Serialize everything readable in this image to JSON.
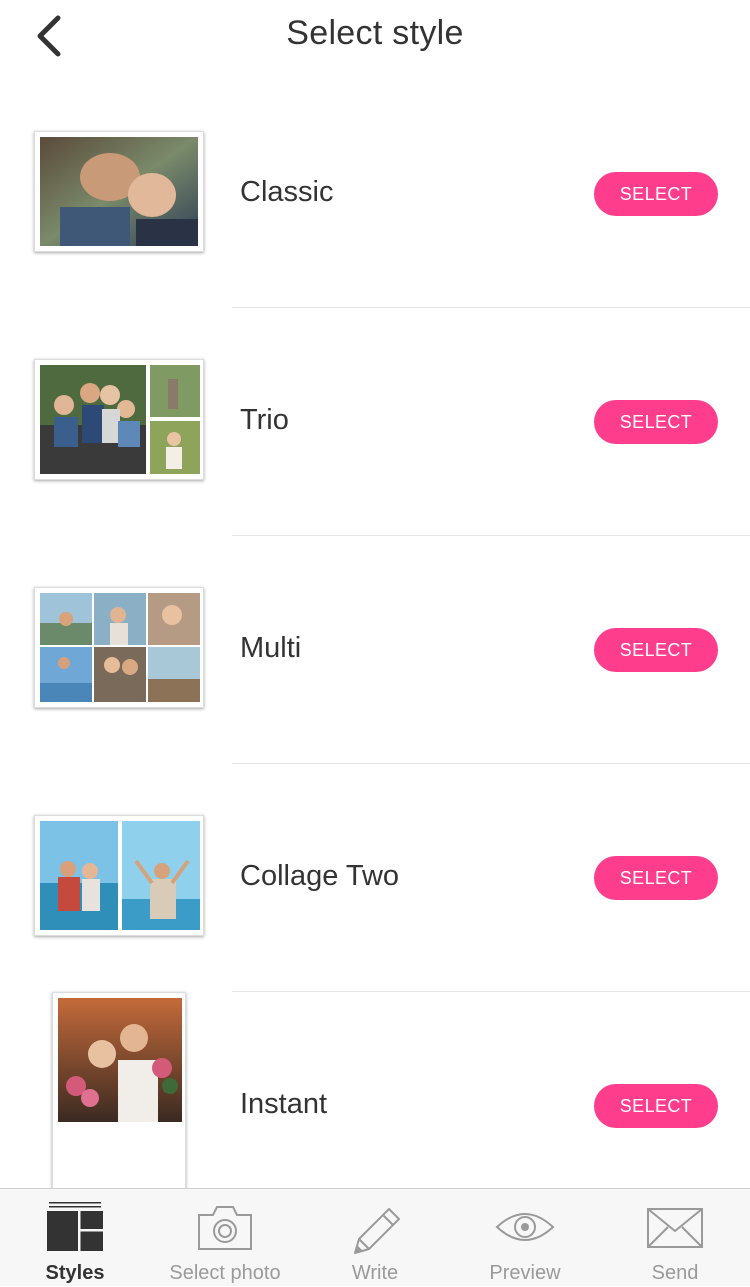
{
  "header": {
    "title": "Select style",
    "back_icon": "chevron-left-icon"
  },
  "styles": [
    {
      "name": "Classic",
      "button": "SELECT"
    },
    {
      "name": "Trio",
      "button": "SELECT"
    },
    {
      "name": "Multi",
      "button": "SELECT"
    },
    {
      "name": "Collage Two",
      "button": "SELECT"
    },
    {
      "name": "Instant",
      "button": "SELECT"
    }
  ],
  "tabs": [
    {
      "label": "Styles",
      "icon": "layout-grid-icon",
      "active": true
    },
    {
      "label": "Select photo",
      "icon": "camera-icon",
      "active": false
    },
    {
      "label": "Write",
      "icon": "pencil-icon",
      "active": false
    },
    {
      "label": "Preview",
      "icon": "eye-icon",
      "active": false
    },
    {
      "label": "Send",
      "icon": "envelope-icon",
      "active": false
    }
  ],
  "colors": {
    "accent": "#ff3d8d",
    "text": "#333333",
    "tab_inactive": "#9a9a9a",
    "tab_bar_bg": "#f7f7f7"
  }
}
